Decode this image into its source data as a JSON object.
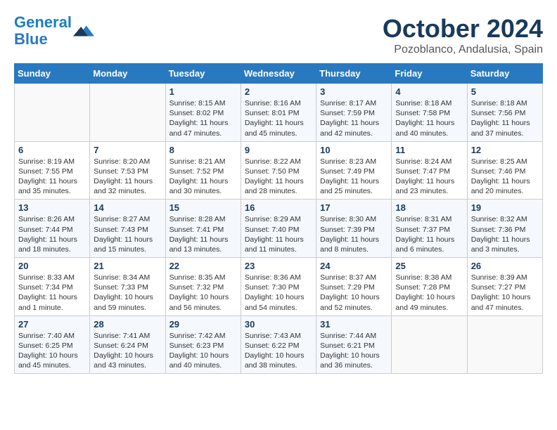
{
  "header": {
    "logo_line1": "General",
    "logo_line2": "Blue",
    "month": "October 2024",
    "location": "Pozoblanco, Andalusia, Spain"
  },
  "weekdays": [
    "Sunday",
    "Monday",
    "Tuesday",
    "Wednesday",
    "Thursday",
    "Friday",
    "Saturday"
  ],
  "weeks": [
    [
      {
        "day": "",
        "info": ""
      },
      {
        "day": "",
        "info": ""
      },
      {
        "day": "1",
        "info": "Sunrise: 8:15 AM\nSunset: 8:02 PM\nDaylight: 11 hours and 47 minutes."
      },
      {
        "day": "2",
        "info": "Sunrise: 8:16 AM\nSunset: 8:01 PM\nDaylight: 11 hours and 45 minutes."
      },
      {
        "day": "3",
        "info": "Sunrise: 8:17 AM\nSunset: 7:59 PM\nDaylight: 11 hours and 42 minutes."
      },
      {
        "day": "4",
        "info": "Sunrise: 8:18 AM\nSunset: 7:58 PM\nDaylight: 11 hours and 40 minutes."
      },
      {
        "day": "5",
        "info": "Sunrise: 8:18 AM\nSunset: 7:56 PM\nDaylight: 11 hours and 37 minutes."
      }
    ],
    [
      {
        "day": "6",
        "info": "Sunrise: 8:19 AM\nSunset: 7:55 PM\nDaylight: 11 hours and 35 minutes."
      },
      {
        "day": "7",
        "info": "Sunrise: 8:20 AM\nSunset: 7:53 PM\nDaylight: 11 hours and 32 minutes."
      },
      {
        "day": "8",
        "info": "Sunrise: 8:21 AM\nSunset: 7:52 PM\nDaylight: 11 hours and 30 minutes."
      },
      {
        "day": "9",
        "info": "Sunrise: 8:22 AM\nSunset: 7:50 PM\nDaylight: 11 hours and 28 minutes."
      },
      {
        "day": "10",
        "info": "Sunrise: 8:23 AM\nSunset: 7:49 PM\nDaylight: 11 hours and 25 minutes."
      },
      {
        "day": "11",
        "info": "Sunrise: 8:24 AM\nSunset: 7:47 PM\nDaylight: 11 hours and 23 minutes."
      },
      {
        "day": "12",
        "info": "Sunrise: 8:25 AM\nSunset: 7:46 PM\nDaylight: 11 hours and 20 minutes."
      }
    ],
    [
      {
        "day": "13",
        "info": "Sunrise: 8:26 AM\nSunset: 7:44 PM\nDaylight: 11 hours and 18 minutes."
      },
      {
        "day": "14",
        "info": "Sunrise: 8:27 AM\nSunset: 7:43 PM\nDaylight: 11 hours and 15 minutes."
      },
      {
        "day": "15",
        "info": "Sunrise: 8:28 AM\nSunset: 7:41 PM\nDaylight: 11 hours and 13 minutes."
      },
      {
        "day": "16",
        "info": "Sunrise: 8:29 AM\nSunset: 7:40 PM\nDaylight: 11 hours and 11 minutes."
      },
      {
        "day": "17",
        "info": "Sunrise: 8:30 AM\nSunset: 7:39 PM\nDaylight: 11 hours and 8 minutes."
      },
      {
        "day": "18",
        "info": "Sunrise: 8:31 AM\nSunset: 7:37 PM\nDaylight: 11 hours and 6 minutes."
      },
      {
        "day": "19",
        "info": "Sunrise: 8:32 AM\nSunset: 7:36 PM\nDaylight: 11 hours and 3 minutes."
      }
    ],
    [
      {
        "day": "20",
        "info": "Sunrise: 8:33 AM\nSunset: 7:34 PM\nDaylight: 11 hours and 1 minute."
      },
      {
        "day": "21",
        "info": "Sunrise: 8:34 AM\nSunset: 7:33 PM\nDaylight: 10 hours and 59 minutes."
      },
      {
        "day": "22",
        "info": "Sunrise: 8:35 AM\nSunset: 7:32 PM\nDaylight: 10 hours and 56 minutes."
      },
      {
        "day": "23",
        "info": "Sunrise: 8:36 AM\nSunset: 7:30 PM\nDaylight: 10 hours and 54 minutes."
      },
      {
        "day": "24",
        "info": "Sunrise: 8:37 AM\nSunset: 7:29 PM\nDaylight: 10 hours and 52 minutes."
      },
      {
        "day": "25",
        "info": "Sunrise: 8:38 AM\nSunset: 7:28 PM\nDaylight: 10 hours and 49 minutes."
      },
      {
        "day": "26",
        "info": "Sunrise: 8:39 AM\nSunset: 7:27 PM\nDaylight: 10 hours and 47 minutes."
      }
    ],
    [
      {
        "day": "27",
        "info": "Sunrise: 7:40 AM\nSunset: 6:25 PM\nDaylight: 10 hours and 45 minutes."
      },
      {
        "day": "28",
        "info": "Sunrise: 7:41 AM\nSunset: 6:24 PM\nDaylight: 10 hours and 43 minutes."
      },
      {
        "day": "29",
        "info": "Sunrise: 7:42 AM\nSunset: 6:23 PM\nDaylight: 10 hours and 40 minutes."
      },
      {
        "day": "30",
        "info": "Sunrise: 7:43 AM\nSunset: 6:22 PM\nDaylight: 10 hours and 38 minutes."
      },
      {
        "day": "31",
        "info": "Sunrise: 7:44 AM\nSunset: 6:21 PM\nDaylight: 10 hours and 36 minutes."
      },
      {
        "day": "",
        "info": ""
      },
      {
        "day": "",
        "info": ""
      }
    ]
  ]
}
